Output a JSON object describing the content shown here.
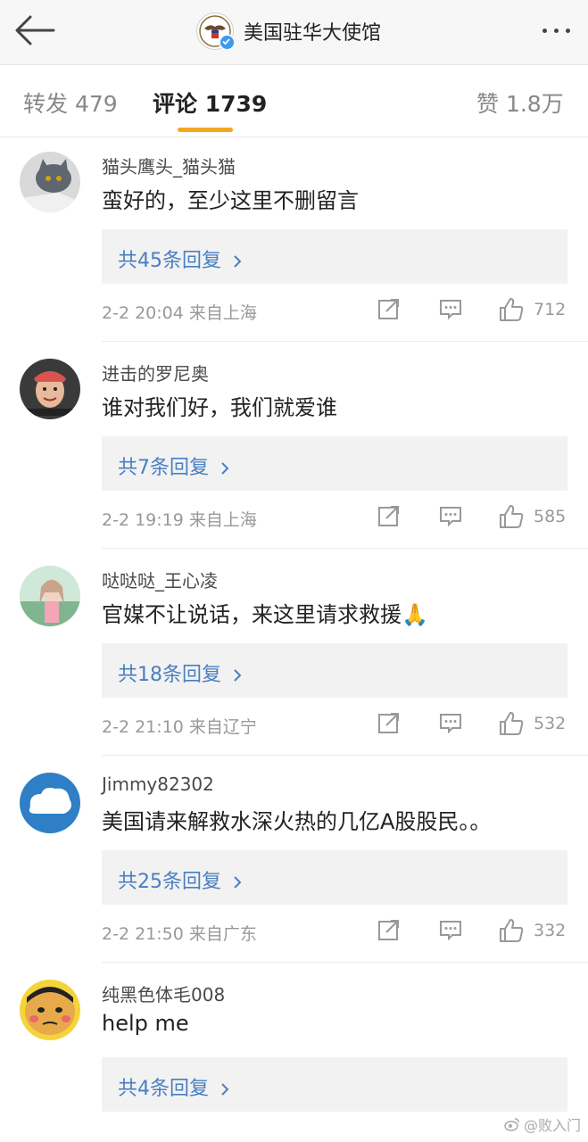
{
  "header": {
    "title": "美国驻华大使馆",
    "icons": [
      "back-arrow-icon",
      "eagle-seal-avatar",
      "verified-icon",
      "more-icon"
    ]
  },
  "tabs": [
    {
      "label": "转发 479",
      "active": false
    },
    {
      "label": "评论 1739",
      "active": true
    },
    {
      "label": "赞 1.8万",
      "active": false
    }
  ],
  "accent_color": "#f5a623",
  "link_color": "#4a7fc1",
  "comments": [
    {
      "user": "猫头鹰头_猫头猫",
      "text": "蛮好的，至少这里不删留言",
      "replies": "共45条回复",
      "meta": "2-2 20:04  来自上海",
      "likes": "712"
    },
    {
      "user": "进击的罗尼奥",
      "text": "谁对我们好，我们就爱谁",
      "replies": "共7条回复",
      "meta": "2-2 19:19  来自上海",
      "likes": "585"
    },
    {
      "user": "哒哒哒_王心凌",
      "text": "官媒不让说话，来这里请求救援🙏",
      "replies": "共18条回复",
      "meta": "2-2 21:10  来自辽宁",
      "likes": "532"
    },
    {
      "user": "Jimmy82302",
      "text": "美国请来解救水深火热的几亿A股股民。。",
      "replies": "共25条回复",
      "meta": "2-2 21:50  来自广东",
      "likes": "332"
    },
    {
      "user": "纯黑色体毛008",
      "text": "help me",
      "replies": "共4条回复",
      "meta": "",
      "likes": ""
    }
  ],
  "watermark": "@败入门"
}
